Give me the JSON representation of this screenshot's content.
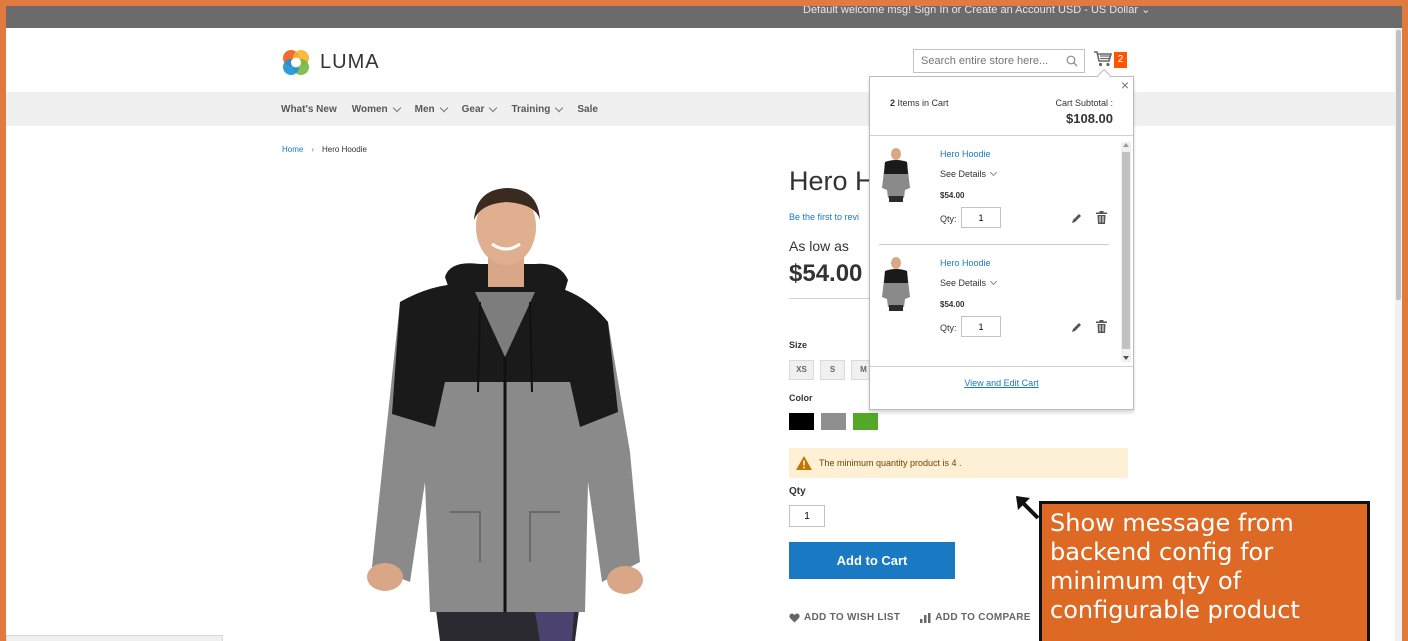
{
  "topbar": {
    "text": "Default welcome msg!  Sign In  or  Create an Account   USD - US Dollar ⌄"
  },
  "header": {
    "logo_text": "LUMA",
    "search_placeholder": "Search entire store here...",
    "cart_count": "2"
  },
  "nav": {
    "items": [
      {
        "label": "What's New",
        "has_dropdown": false
      },
      {
        "label": "Women",
        "has_dropdown": true
      },
      {
        "label": "Men",
        "has_dropdown": true
      },
      {
        "label": "Gear",
        "has_dropdown": true
      },
      {
        "label": "Training",
        "has_dropdown": true
      },
      {
        "label": "Sale",
        "has_dropdown": false
      }
    ]
  },
  "breadcrumb": {
    "home": "Home",
    "current": "Hero Hoodie"
  },
  "product": {
    "title": "Hero H",
    "review_link": "Be the first to revi",
    "as_low_as": "As low as",
    "price": "$54.00",
    "size_label": "Size",
    "sizes": [
      "XS",
      "S",
      "M"
    ],
    "color_label": "Color",
    "colors": [
      "#000000",
      "#8f8f8f",
      "#53a828"
    ],
    "notice": "The minimum quantity product is 4 .",
    "qty_label": "Qty",
    "qty_value": "1",
    "add_to_cart": "Add to Cart",
    "wishlist": "ADD TO WISH LIST",
    "compare": "ADD TO COMPARE"
  },
  "minicart": {
    "close": "×",
    "items_count": "2",
    "items_text": " Items in Cart",
    "subtotal_label": "Cart Subtotal :",
    "subtotal": "$108.00",
    "items": [
      {
        "name": "Hero Hoodie",
        "details": "See Details",
        "price": "$54.00",
        "qty_label": "Qty:",
        "qty": "1"
      },
      {
        "name": "Hero Hoodie",
        "details": "See Details",
        "price": "$54.00",
        "qty_label": "Qty:",
        "qty": "1"
      }
    ],
    "view_edit": "View and Edit Cart"
  },
  "annotation": {
    "text": "Show message from backend config for minimum qty of configurable product"
  },
  "colors": {
    "frame": "#e07a3f",
    "accent_blue": "#1979c3",
    "cart_badge": "#ff5501",
    "annotation_bg": "#de6925"
  }
}
